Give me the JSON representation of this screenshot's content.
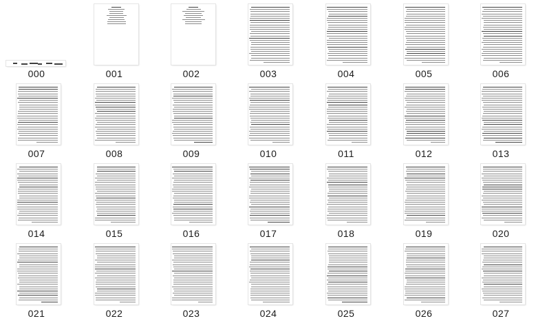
{
  "window": {
    "title": ""
  },
  "view": "large-icons",
  "items": [
    {
      "name": "000",
      "kind": "banner"
    },
    {
      "name": "001",
      "kind": "title"
    },
    {
      "name": "002",
      "kind": "title"
    },
    {
      "name": "003",
      "kind": "text"
    },
    {
      "name": "004",
      "kind": "text"
    },
    {
      "name": "005",
      "kind": "text"
    },
    {
      "name": "006",
      "kind": "text"
    },
    {
      "name": "007",
      "kind": "text"
    },
    {
      "name": "008",
      "kind": "text"
    },
    {
      "name": "009",
      "kind": "text"
    },
    {
      "name": "010",
      "kind": "text"
    },
    {
      "name": "011",
      "kind": "text"
    },
    {
      "name": "012",
      "kind": "text"
    },
    {
      "name": "013",
      "kind": "text"
    },
    {
      "name": "014",
      "kind": "text"
    },
    {
      "name": "015",
      "kind": "text"
    },
    {
      "name": "016",
      "kind": "text"
    },
    {
      "name": "017",
      "kind": "text"
    },
    {
      "name": "018",
      "kind": "text"
    },
    {
      "name": "019",
      "kind": "text"
    },
    {
      "name": "020",
      "kind": "text"
    },
    {
      "name": "021",
      "kind": "text"
    },
    {
      "name": "022",
      "kind": "text"
    },
    {
      "name": "023",
      "kind": "text"
    },
    {
      "name": "024",
      "kind": "text"
    },
    {
      "name": "025",
      "kind": "text"
    },
    {
      "name": "026",
      "kind": "text"
    },
    {
      "name": "027",
      "kind": "text"
    }
  ],
  "colors": {
    "background": "#ffffff",
    "caption": "#1a1a1a",
    "text_lines": "#8a8a8a"
  }
}
